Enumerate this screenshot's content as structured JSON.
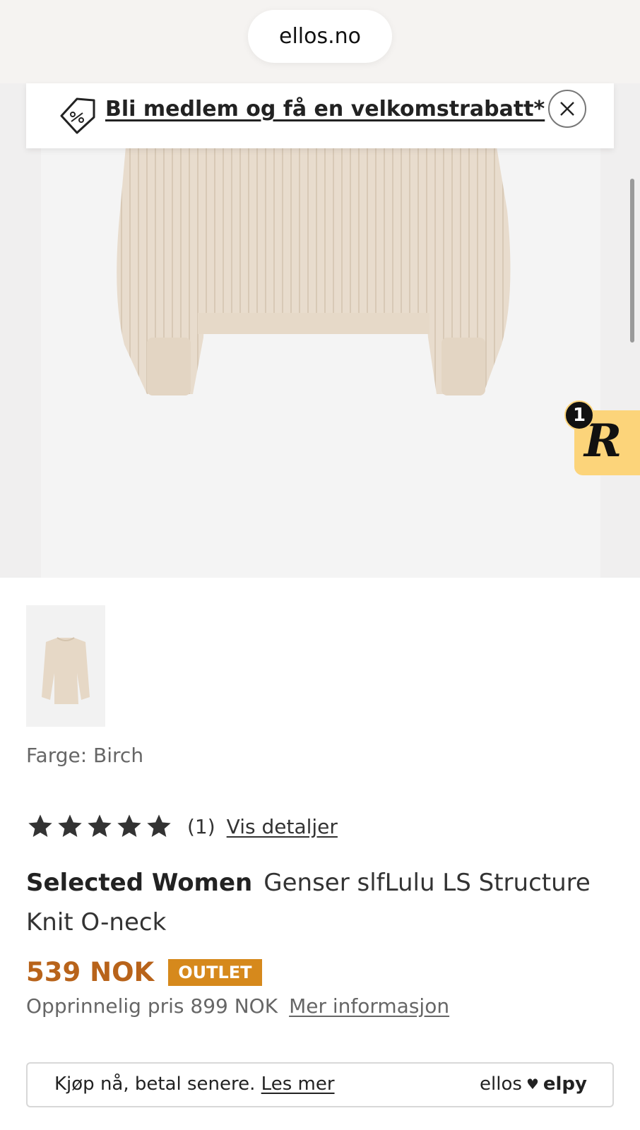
{
  "browser": {
    "url": "ellos.no"
  },
  "promo_banner": {
    "text": "Bli medlem og få en velkomstrabatt*"
  },
  "loyalty_widget": {
    "badge_count": "1",
    "logo_letter": "R"
  },
  "product": {
    "color_label": "Farge: Birch",
    "rating": {
      "stars": 5,
      "count_text": "(1)",
      "details_link": "Vis detaljer"
    },
    "brand": "Selected Women",
    "name": "Genser slfLulu LS Structure Knit O-neck",
    "price": "539 NOK",
    "badge": "OUTLET",
    "original_price": "Opprinnelig pris 899 NOK",
    "more_info_link": "Mer informasjon"
  },
  "payment_banner": {
    "text": "Kjøp nå, betal senere.",
    "link": "Les mer",
    "logo_left": "ellos",
    "logo_right": "elpy"
  },
  "colors": {
    "price": "#b8631a",
    "outlet_badge": "#d6891c",
    "widget": "#fcd47a"
  }
}
